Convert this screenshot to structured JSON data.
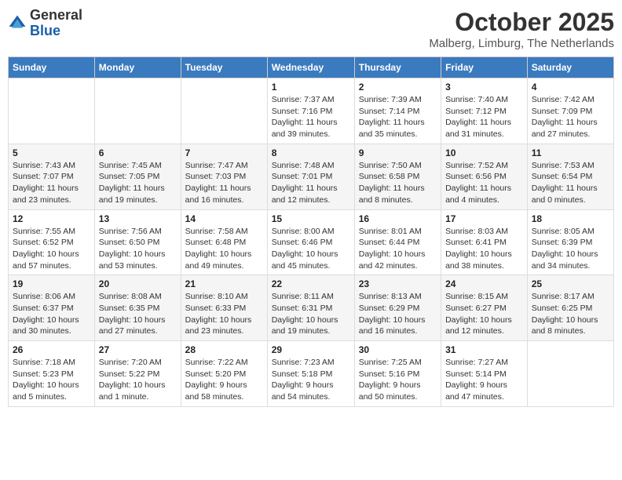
{
  "logo": {
    "general": "General",
    "blue": "Blue"
  },
  "title": {
    "month_year": "October 2025",
    "location": "Malberg, Limburg, The Netherlands"
  },
  "days_of_week": [
    "Sunday",
    "Monday",
    "Tuesday",
    "Wednesday",
    "Thursday",
    "Friday",
    "Saturday"
  ],
  "weeks": [
    [
      {
        "day": "",
        "info": ""
      },
      {
        "day": "",
        "info": ""
      },
      {
        "day": "",
        "info": ""
      },
      {
        "day": "1",
        "info": "Sunrise: 7:37 AM\nSunset: 7:16 PM\nDaylight: 11 hours\nand 39 minutes."
      },
      {
        "day": "2",
        "info": "Sunrise: 7:39 AM\nSunset: 7:14 PM\nDaylight: 11 hours\nand 35 minutes."
      },
      {
        "day": "3",
        "info": "Sunrise: 7:40 AM\nSunset: 7:12 PM\nDaylight: 11 hours\nand 31 minutes."
      },
      {
        "day": "4",
        "info": "Sunrise: 7:42 AM\nSunset: 7:09 PM\nDaylight: 11 hours\nand 27 minutes."
      }
    ],
    [
      {
        "day": "5",
        "info": "Sunrise: 7:43 AM\nSunset: 7:07 PM\nDaylight: 11 hours\nand 23 minutes."
      },
      {
        "day": "6",
        "info": "Sunrise: 7:45 AM\nSunset: 7:05 PM\nDaylight: 11 hours\nand 19 minutes."
      },
      {
        "day": "7",
        "info": "Sunrise: 7:47 AM\nSunset: 7:03 PM\nDaylight: 11 hours\nand 16 minutes."
      },
      {
        "day": "8",
        "info": "Sunrise: 7:48 AM\nSunset: 7:01 PM\nDaylight: 11 hours\nand 12 minutes."
      },
      {
        "day": "9",
        "info": "Sunrise: 7:50 AM\nSunset: 6:58 PM\nDaylight: 11 hours\nand 8 minutes."
      },
      {
        "day": "10",
        "info": "Sunrise: 7:52 AM\nSunset: 6:56 PM\nDaylight: 11 hours\nand 4 minutes."
      },
      {
        "day": "11",
        "info": "Sunrise: 7:53 AM\nSunset: 6:54 PM\nDaylight: 11 hours\nand 0 minutes."
      }
    ],
    [
      {
        "day": "12",
        "info": "Sunrise: 7:55 AM\nSunset: 6:52 PM\nDaylight: 10 hours\nand 57 minutes."
      },
      {
        "day": "13",
        "info": "Sunrise: 7:56 AM\nSunset: 6:50 PM\nDaylight: 10 hours\nand 53 minutes."
      },
      {
        "day": "14",
        "info": "Sunrise: 7:58 AM\nSunset: 6:48 PM\nDaylight: 10 hours\nand 49 minutes."
      },
      {
        "day": "15",
        "info": "Sunrise: 8:00 AM\nSunset: 6:46 PM\nDaylight: 10 hours\nand 45 minutes."
      },
      {
        "day": "16",
        "info": "Sunrise: 8:01 AM\nSunset: 6:44 PM\nDaylight: 10 hours\nand 42 minutes."
      },
      {
        "day": "17",
        "info": "Sunrise: 8:03 AM\nSunset: 6:41 PM\nDaylight: 10 hours\nand 38 minutes."
      },
      {
        "day": "18",
        "info": "Sunrise: 8:05 AM\nSunset: 6:39 PM\nDaylight: 10 hours\nand 34 minutes."
      }
    ],
    [
      {
        "day": "19",
        "info": "Sunrise: 8:06 AM\nSunset: 6:37 PM\nDaylight: 10 hours\nand 30 minutes."
      },
      {
        "day": "20",
        "info": "Sunrise: 8:08 AM\nSunset: 6:35 PM\nDaylight: 10 hours\nand 27 minutes."
      },
      {
        "day": "21",
        "info": "Sunrise: 8:10 AM\nSunset: 6:33 PM\nDaylight: 10 hours\nand 23 minutes."
      },
      {
        "day": "22",
        "info": "Sunrise: 8:11 AM\nSunset: 6:31 PM\nDaylight: 10 hours\nand 19 minutes."
      },
      {
        "day": "23",
        "info": "Sunrise: 8:13 AM\nSunset: 6:29 PM\nDaylight: 10 hours\nand 16 minutes."
      },
      {
        "day": "24",
        "info": "Sunrise: 8:15 AM\nSunset: 6:27 PM\nDaylight: 10 hours\nand 12 minutes."
      },
      {
        "day": "25",
        "info": "Sunrise: 8:17 AM\nSunset: 6:25 PM\nDaylight: 10 hours\nand 8 minutes."
      }
    ],
    [
      {
        "day": "26",
        "info": "Sunrise: 7:18 AM\nSunset: 5:23 PM\nDaylight: 10 hours\nand 5 minutes."
      },
      {
        "day": "27",
        "info": "Sunrise: 7:20 AM\nSunset: 5:22 PM\nDaylight: 10 hours\nand 1 minute."
      },
      {
        "day": "28",
        "info": "Sunrise: 7:22 AM\nSunset: 5:20 PM\nDaylight: 9 hours\nand 58 minutes."
      },
      {
        "day": "29",
        "info": "Sunrise: 7:23 AM\nSunset: 5:18 PM\nDaylight: 9 hours\nand 54 minutes."
      },
      {
        "day": "30",
        "info": "Sunrise: 7:25 AM\nSunset: 5:16 PM\nDaylight: 9 hours\nand 50 minutes."
      },
      {
        "day": "31",
        "info": "Sunrise: 7:27 AM\nSunset: 5:14 PM\nDaylight: 9 hours\nand 47 minutes."
      },
      {
        "day": "",
        "info": ""
      }
    ]
  ]
}
